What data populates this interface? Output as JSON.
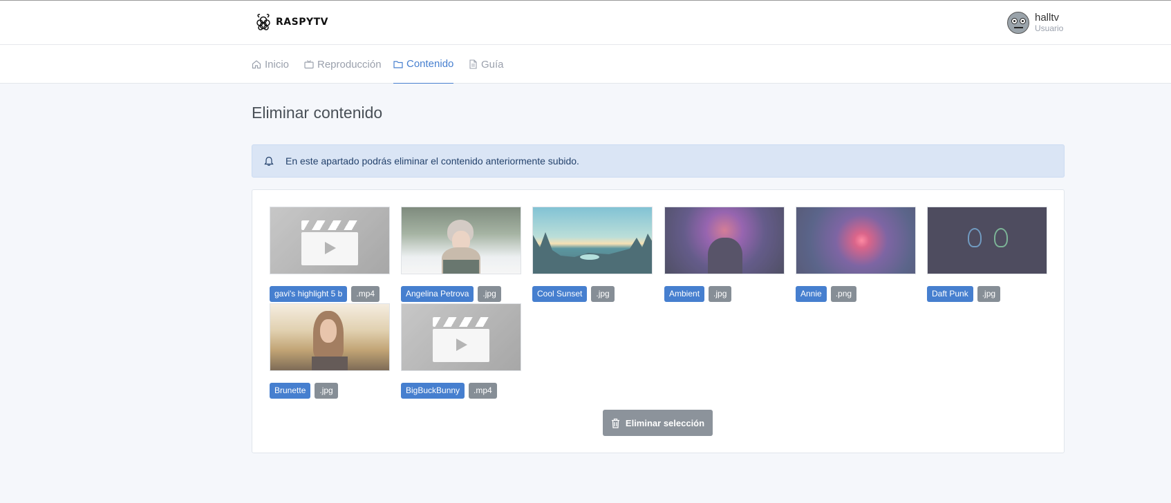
{
  "app": {
    "brand": "RASPYTV"
  },
  "user": {
    "name": "halltv",
    "role": "Usuario"
  },
  "nav": {
    "items": [
      {
        "label": "Inicio",
        "icon": "home-icon"
      },
      {
        "label": "Reproducción",
        "icon": "tv-icon"
      },
      {
        "label": "Contenido",
        "icon": "folder-icon",
        "active": true
      },
      {
        "label": "Guía",
        "icon": "file-icon"
      }
    ]
  },
  "page": {
    "title": "Eliminar contenido"
  },
  "alert": {
    "text": "En este apartado podrás eliminar el contenido anteriormente subido.",
    "icon": "bell-icon"
  },
  "media": [
    {
      "name": "gavi's highlight 5 b",
      "ext": ".mp4",
      "thumb": "video-placeholder"
    },
    {
      "name": "Angelina Petrova",
      "ext": ".jpg",
      "thumb": "portrait-snow"
    },
    {
      "name": "Cool Sunset",
      "ext": ".jpg",
      "thumb": "landscape-sunset"
    },
    {
      "name": "Ambient",
      "ext": ".jpg",
      "thumb": "abstract-purple"
    },
    {
      "name": "Annie",
      "ext": ".png",
      "thumb": "abstract-fire"
    },
    {
      "name": "Daft Punk",
      "ext": ".jpg",
      "thumb": "helmets-dark"
    },
    {
      "name": "Brunette",
      "ext": ".jpg",
      "thumb": "portrait-field"
    },
    {
      "name": "BigBuckBunny",
      "ext": ".mp4",
      "thumb": "video-placeholder"
    }
  ],
  "actions": {
    "delete_label": "Eliminar selección",
    "delete_icon": "trash-icon"
  },
  "colors": {
    "primary": "#467fcf",
    "secondary": "#868e96",
    "alert_bg": "#dae5f5"
  }
}
